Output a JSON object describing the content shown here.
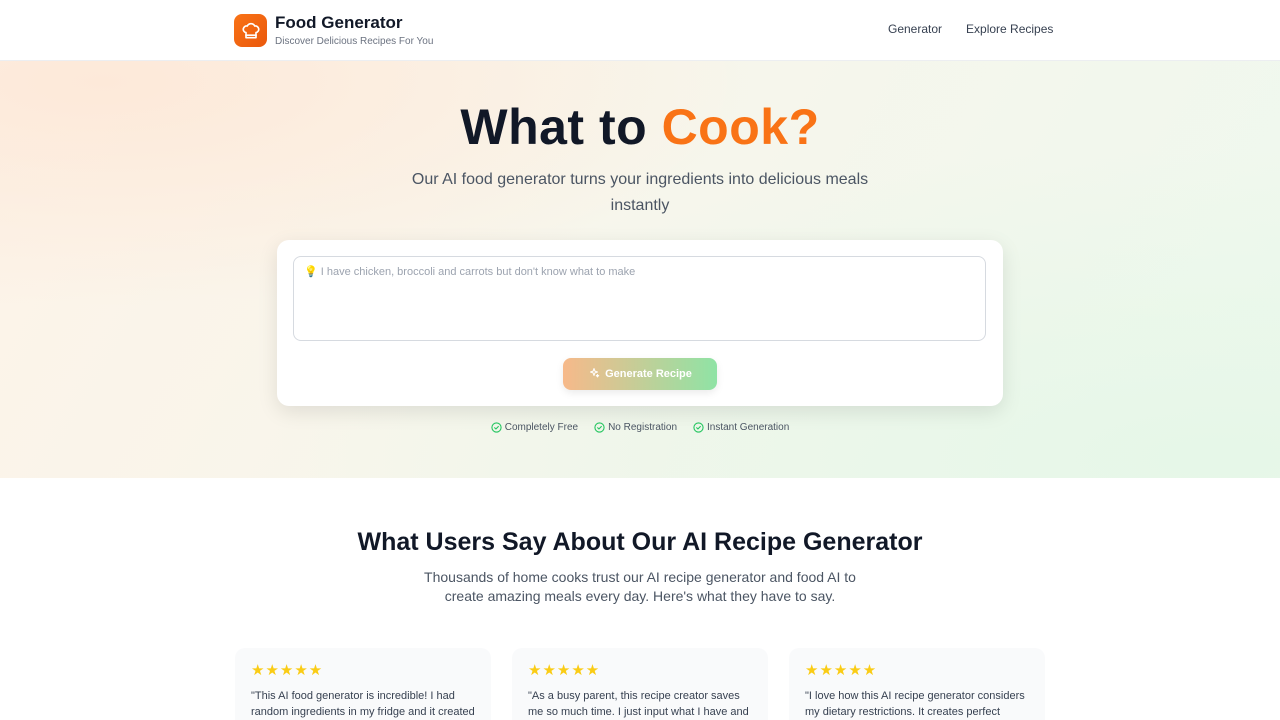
{
  "header": {
    "brand_title": "Food Generator",
    "brand_subtitle": "Discover Delicious Recipes For You",
    "nav": [
      "Generator",
      "Explore Recipes"
    ]
  },
  "hero": {
    "title_main": "What to ",
    "title_accent": "Cook?",
    "subtitle": "Our AI food generator turns your ingredients into delicious meals instantly",
    "input_placeholder": "💡 I have chicken, broccoli and carrots but don't know what to make",
    "button_label": "Generate Recipe",
    "features": [
      "Completely Free",
      "No Registration",
      "Instant Generation"
    ]
  },
  "testimonials": {
    "title": "What Users Say About Our AI Recipe Generator",
    "subtitle": "Thousands of home cooks trust our AI recipe generator and food AI to create amazing meals every day. Here's what they have to say.",
    "cards": [
      {
        "stars": "★★★★★",
        "rating": 5,
        "quote": "\"This AI food generator is incredible! I had random ingredients in my fridge and it created"
      },
      {
        "stars": "★★★★★",
        "rating": 5,
        "quote": "\"As a busy parent, this recipe creator saves me so much time. I just input what I have and get"
      },
      {
        "stars": "★★★★★",
        "rating": 5,
        "quote": "\"I love how this AI recipe generator considers my dietary restrictions. It creates perfect vegan"
      }
    ]
  },
  "colors": {
    "accent": "#f97316",
    "check": "#22c55e",
    "star": "#facc15"
  },
  "icons": {
    "logo": "chef-hat-icon",
    "button": "sparkle-icon",
    "feature": "check-circle-icon"
  }
}
